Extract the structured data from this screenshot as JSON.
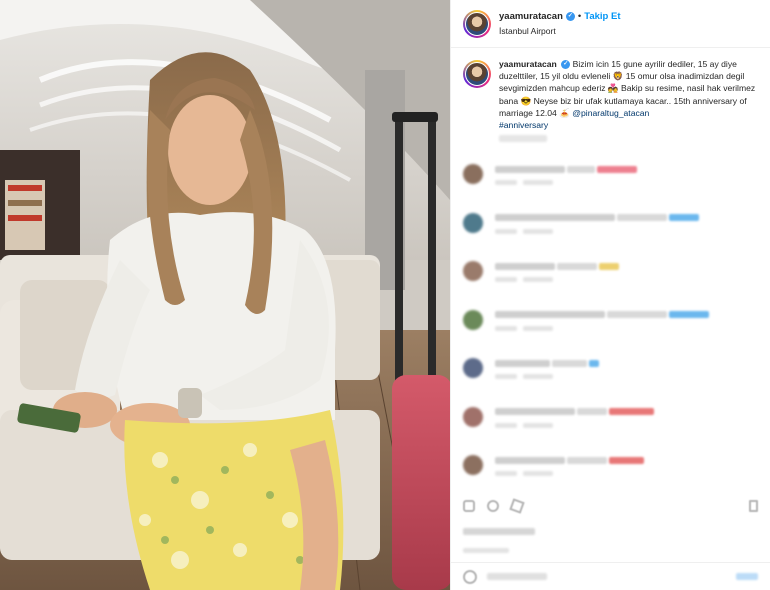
{
  "post": {
    "username": "yaamuratacan",
    "follow_label": "Takip Et",
    "location": "İstanbul Airport",
    "verified_mark": "✓",
    "separator": "•"
  },
  "caption": {
    "username": "yaamuratacan",
    "text": "Bizim icin 15 gune ayrilir dediler, 15 ay diye duzelttiler, 15 yil oldu evleneli 🦁 15 omur olsa inadimizdan degil sevgimizden mahcup ederiz 💑 Bakip su resime, nasil hak verilmez bana 😎 Neyse biz bir ufak kutlamaya kacar.. 15th anniversary of marriage 12.04 🍝",
    "mention": "@pinaraltug_atacan",
    "hashtag": "#anniversary"
  },
  "comments": [
    {
      "avatar_color": "#8a6f5e",
      "accent": "#e8566a"
    },
    {
      "avatar_color": "#4f7a8c",
      "accent": "#3aa0e8"
    },
    {
      "avatar_color": "#9a7b6b",
      "accent": "#e7c040"
    },
    {
      "avatar_color": "#6b8a5a",
      "accent": "#3aa0e8"
    },
    {
      "avatar_color": "#5d6b8a",
      "accent": "#3aa0e8"
    },
    {
      "avatar_color": "#a0716a",
      "accent": "#e04a4a"
    },
    {
      "avatar_color": "#8c7060",
      "accent": "#e04a4a"
    }
  ],
  "colors": {
    "follow_blue": "#0095f6",
    "link_blue": "#00376b",
    "verified_blue": "#3897f0",
    "border": "#efefef"
  },
  "icons": [
    "heart-icon",
    "comment-icon",
    "share-icon",
    "bookmark-icon",
    "emoji-icon"
  ]
}
